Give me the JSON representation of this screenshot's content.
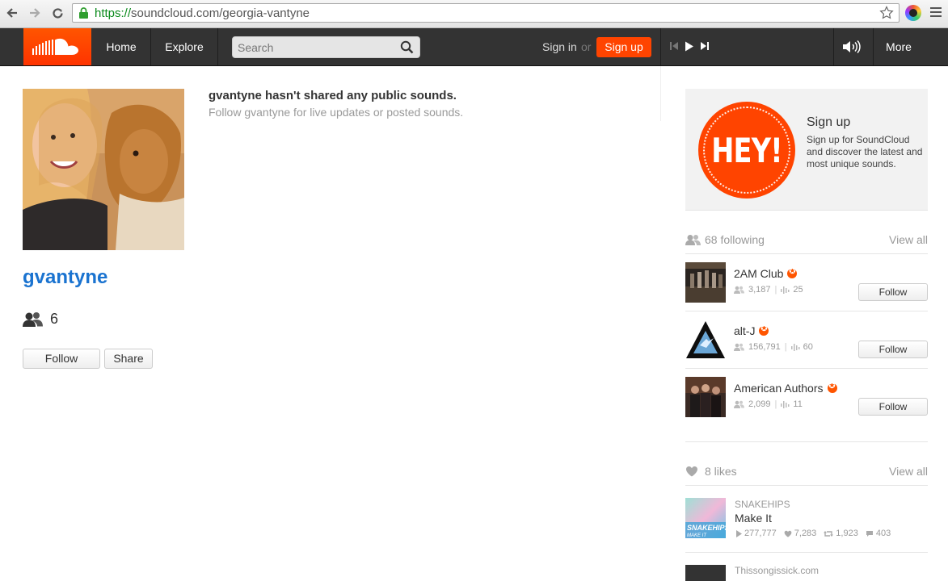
{
  "browser": {
    "url_scheme": "https://",
    "url_rest": "soundcloud.com/georgia-vantyne"
  },
  "header": {
    "home": "Home",
    "explore": "Explore",
    "search_placeholder": "Search",
    "sign_in": "Sign in",
    "or": "or",
    "sign_up": "Sign up",
    "more": "More",
    "accent": "#ff5500"
  },
  "profile": {
    "username": "gvantyne",
    "follower_count": "6",
    "follow_label": "Follow",
    "share_label": "Share",
    "empty_title": "gvantyne hasn't shared any public sounds.",
    "empty_subtitle": "Follow gvantyne for live updates or posted sounds."
  },
  "promo": {
    "badge_text": "HEY!",
    "title": "Sign up",
    "body": "Sign up for SoundCloud and discover the latest and most unique sounds."
  },
  "following": {
    "count_label": "68 following",
    "view_all": "View all",
    "users": [
      {
        "name": "2AM Club",
        "followers": "3,187",
        "tracks": "25",
        "follow_label": "Follow"
      },
      {
        "name": "alt-J",
        "followers": "156,791",
        "tracks": "60",
        "follow_label": "Follow"
      },
      {
        "name": "American Authors",
        "followers": "2,099",
        "tracks": "11",
        "follow_label": "Follow"
      }
    ]
  },
  "likes": {
    "count_label": "8 likes",
    "view_all": "View all",
    "items": [
      {
        "artist": "SNAKEHIPS",
        "title": "Make It",
        "plays": "277,777",
        "likes": "7,283",
        "reposts": "1,923",
        "comments": "403",
        "art_text": "SNAKEHIPS",
        "art_sub": "MAKE IT"
      }
    ],
    "next_partial": "Thissongissick.com"
  }
}
